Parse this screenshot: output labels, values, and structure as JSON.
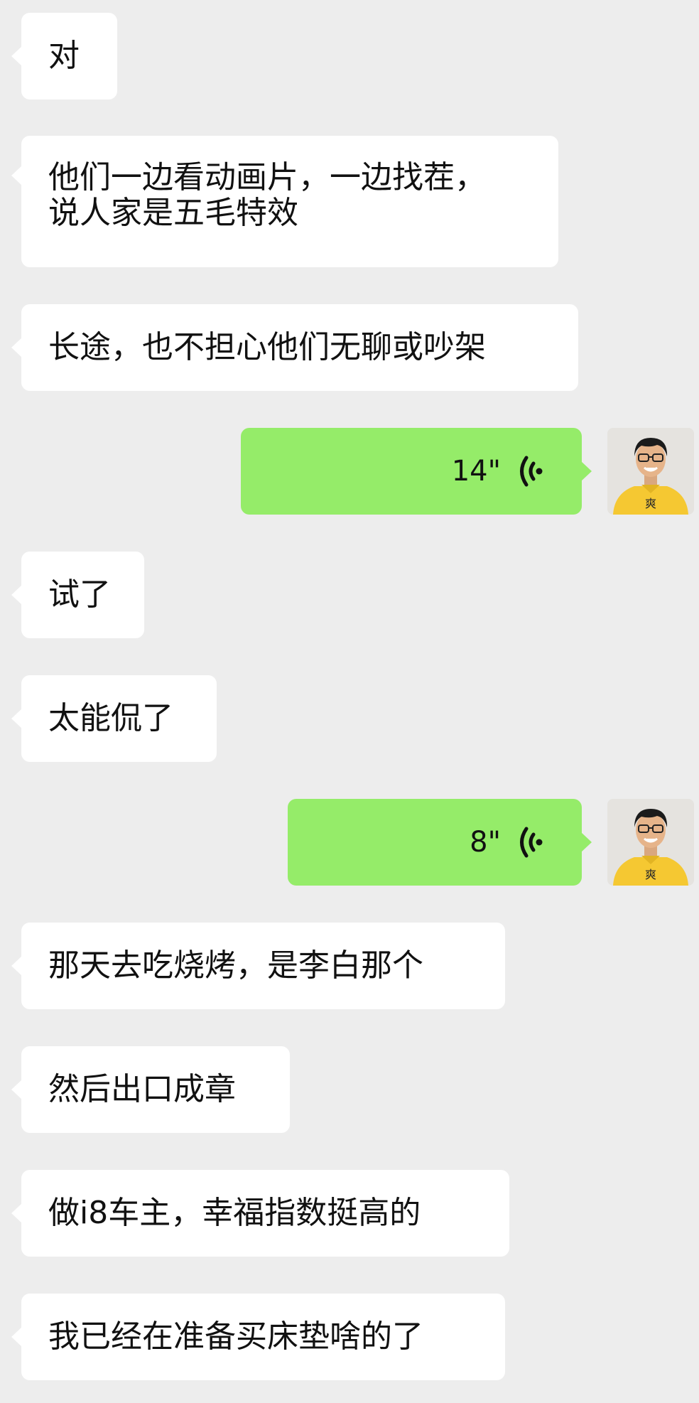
{
  "messages": [
    {
      "side": "left",
      "lines": [
        "对"
      ]
    },
    {
      "side": "left",
      "lines": [
        "他们一边看动画片，一边找茬，",
        "说人家是五毛特效"
      ]
    },
    {
      "side": "left",
      "lines": [
        "长途，也不担心他们无聊或吵架"
      ]
    },
    {
      "side": "right",
      "type": "voice",
      "duration": "14\"",
      "icon": "voice-wave-icon",
      "avatar": "avatar"
    },
    {
      "side": "left",
      "lines": [
        "试了"
      ]
    },
    {
      "side": "left",
      "lines": [
        "太能侃了"
      ]
    },
    {
      "side": "right",
      "type": "voice",
      "duration": "8\"",
      "icon": "voice-wave-icon",
      "avatar": "avatar"
    },
    {
      "side": "left",
      "lines": [
        "那天去吃烧烤，是李白那个"
      ]
    },
    {
      "side": "left",
      "lines": [
        "然后出口成章"
      ]
    },
    {
      "side": "left",
      "lines": [
        "做i8车主，幸福指数挺高的"
      ]
    },
    {
      "side": "left",
      "lines": [
        "我已经在准备买床垫啥的了"
      ]
    }
  ],
  "avatar_shirt_text": "爽",
  "colors": {
    "background": "#ededed",
    "incoming_bubble": "#ffffff",
    "outgoing_bubble": "#95ec69",
    "avatar_shirt": "#f5c832"
  }
}
